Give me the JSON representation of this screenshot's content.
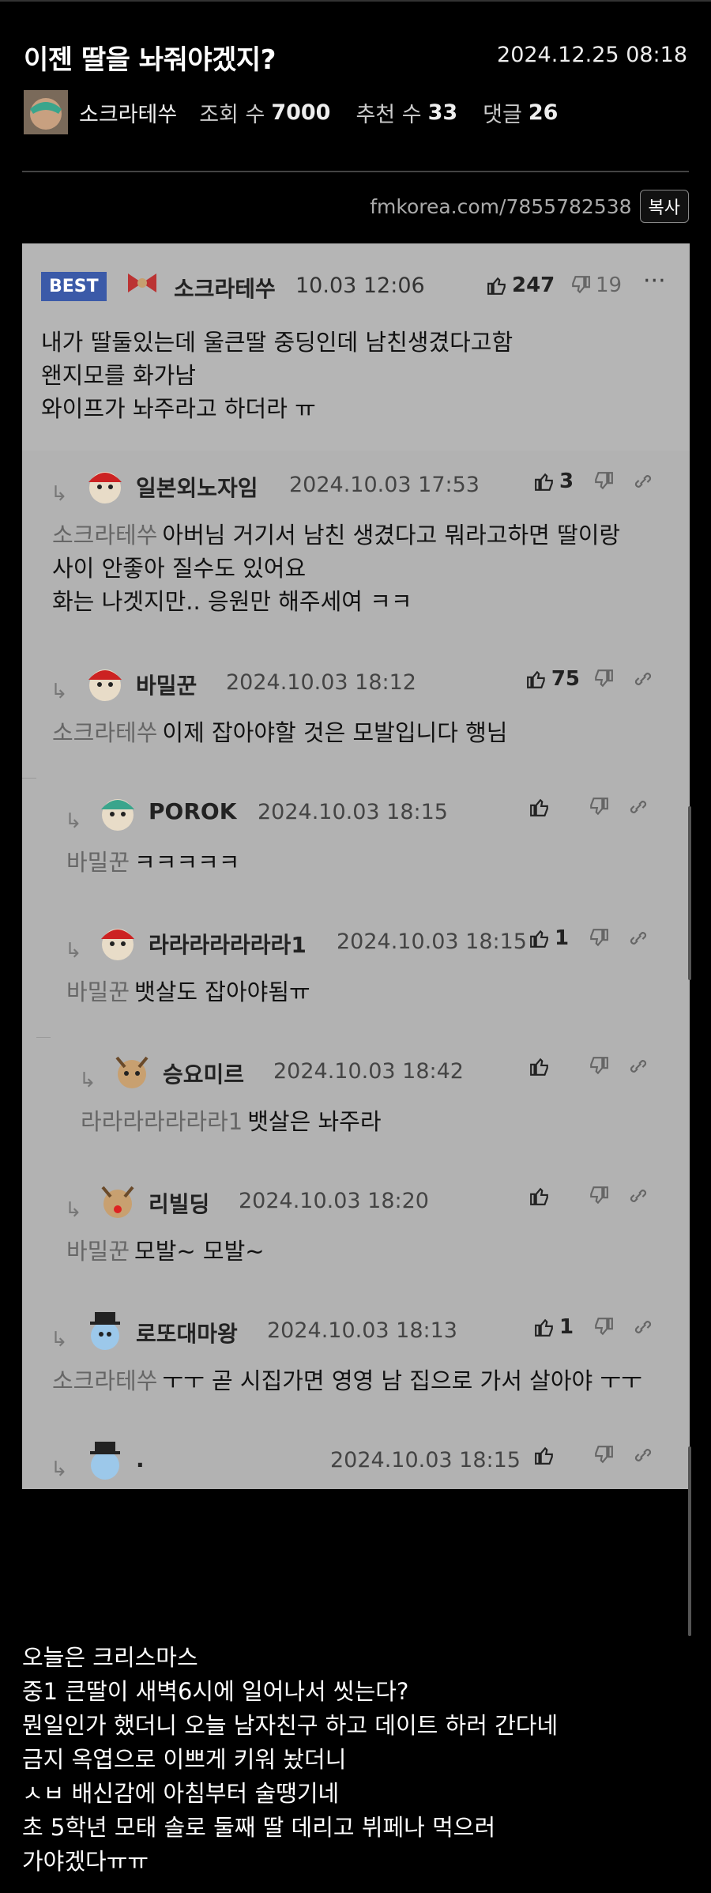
{
  "post": {
    "title": "이젠 딸을 놔줘야겠지?",
    "date": "2024.12.25 08:18",
    "author": "소크라테쑤",
    "views_label": "조회 수",
    "views": "7000",
    "recommend_label": "추천 수",
    "recommend": "33",
    "comments_label": "댓글",
    "comments": "26",
    "url": "fmkorea.com/7855782538",
    "copy_label": "복사"
  },
  "best": {
    "badge": "BEST",
    "nick": "소크라테쑤",
    "time": "10.03 12:06",
    "likes": "247",
    "dislikes": "19",
    "lines": [
      "내가 딸둘있는데 울큰딸 중딩인데 남친생겼다고함",
      "왠지모를 화가남",
      "와이프가 놔주라고 하더라 ㅠ"
    ]
  },
  "replies": [
    {
      "nick": "일본외노자임",
      "time": "2024.10.03 17:53",
      "likes": "3",
      "mention": "소크라테쑤",
      "text": "아버님 거기서 남친 생겼다고 뭐라고하면 딸이랑",
      "text2": "사이 안좋아 질수도 있어요",
      "text3": "화는 나겟지만.. 응원만 해주세여 ㅋㅋ"
    },
    {
      "nick": "바밀꾼",
      "time": "2024.10.03 18:12",
      "likes": "75",
      "mention": "소크라테쑤",
      "text": "이제 잡아야할 것은 모발입니다 행님"
    },
    {
      "nick": "POROK",
      "time": "2024.10.03 18:15",
      "likes": "",
      "mention": "바밀꾼",
      "text": "ㅋㅋㅋㅋㅋ"
    },
    {
      "nick": "라라라라라라라1",
      "time": "2024.10.03 18:15",
      "likes": "1",
      "mention": "바밀꾼",
      "text": "뱃살도 잡아야됨ㅠ"
    },
    {
      "nick": "승요미르",
      "time": "2024.10.03 18:42",
      "likes": "",
      "mention": "라라라라라라라1",
      "text": "뱃살은 놔주라"
    },
    {
      "nick": "리빌딩",
      "time": "2024.10.03 18:20",
      "likes": "",
      "mention": "바밀꾼",
      "text": "모발~ 모발~"
    },
    {
      "nick": "로또대마왕",
      "time": "2024.10.03 18:13",
      "likes": "1",
      "mention": "소크라테쑤",
      "text": "ㅜㅜ 곧 시집가면 영영 남 집으로 가서 살아야 ㅜㅜ"
    }
  ],
  "partial": {
    "nick": ".",
    "time": "2024.10.03 18:15"
  },
  "story": [
    "오늘은 크리스마스",
    "중1 큰딸이 새벽6시에 일어나서 씻는다?",
    "뭔일인가 했더니 오늘 남자친구 하고 데이트 하러 간다네",
    "금지 옥엽으로 이쁘게 키워 놨더니",
    "ㅅㅂ 배신감에 아침부터 술땡기네",
    "초 5학년 모태 솔로 둘째 딸 데리고 뷔페나 먹으러",
    "가야겠다ㅠㅠ"
  ]
}
